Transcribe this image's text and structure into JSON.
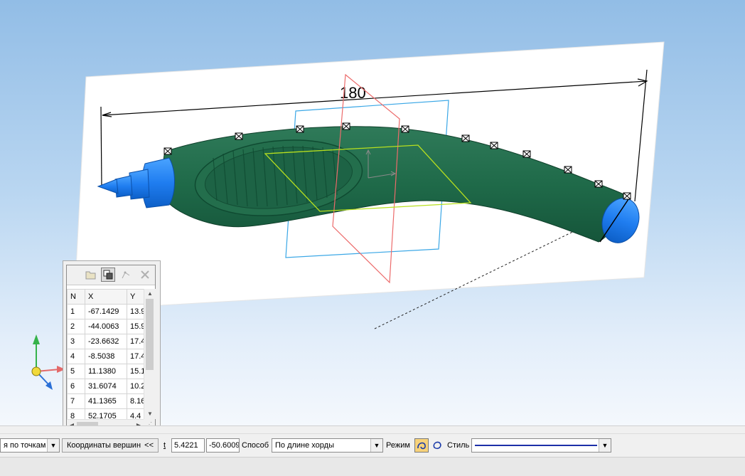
{
  "viewport": {
    "dimension_label": "180",
    "axis_icon": "xyz-axis-triad-icon"
  },
  "coord_panel": {
    "toolbar_icons": [
      "open-folder-icon",
      "copy-points-icon",
      "add-vertex-icon",
      "delete-icon"
    ],
    "columns": [
      "N",
      "X",
      "Y"
    ],
    "rows": [
      {
        "n": "1",
        "x": "-67.1429",
        "y": "13.9"
      },
      {
        "n": "2",
        "x": "-44.0063",
        "y": "15.9"
      },
      {
        "n": "3",
        "x": "-23.6632",
        "y": "17.4"
      },
      {
        "n": "4",
        "x": "-8.5038",
        "y": "17.4"
      },
      {
        "n": "5",
        "x": "11.1380",
        "y": "15.1"
      },
      {
        "n": "6",
        "x": "31.6074",
        "y": "10.2"
      },
      {
        "n": "7",
        "x": "41.1365",
        "y": "8.16"
      },
      {
        "n": "8",
        "x": "52.1705",
        "y": "4.4"
      }
    ]
  },
  "propbar": {
    "build_mode": "я по точкам",
    "coord_tab": "Координаты вершин",
    "collapse": "<<",
    "t_label": "t",
    "t_value": "5.4221",
    "t_value2": "-50.6009",
    "method_label": "Способ",
    "method_value": "По длине хорды",
    "mode_label": "Режим",
    "style_label": "Стиль",
    "style_color": "#1c2fa8"
  }
}
